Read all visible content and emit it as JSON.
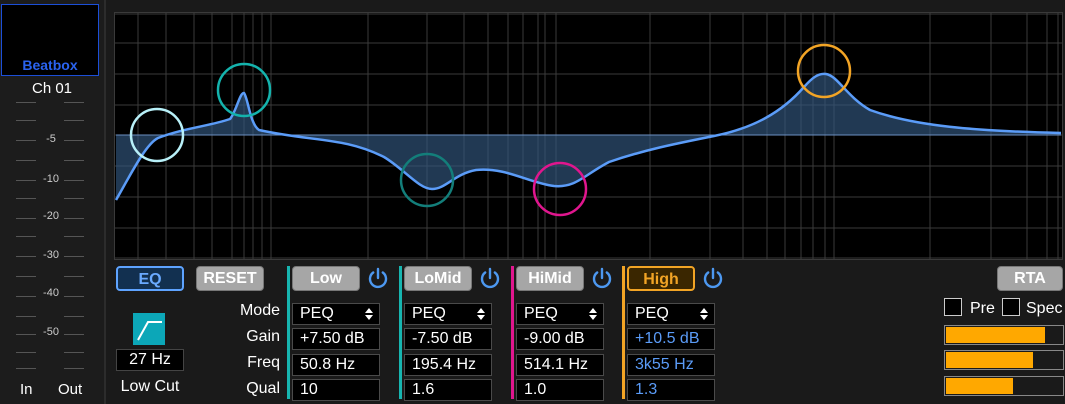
{
  "channel": {
    "name": "Beatbox",
    "number": "Ch 01"
  },
  "meter": {
    "scale_labels": [
      "-5",
      "-10",
      "-20",
      "-30",
      "-40",
      "-50"
    ],
    "in_label": "In",
    "out_label": "Out"
  },
  "graph": {
    "accent_color": "#5b9cf8",
    "band_markers": [
      {
        "name": "Low Cut",
        "color": "#b8f0f8"
      },
      {
        "name": "Low",
        "color": "#14b3ad"
      },
      {
        "name": "LoMid",
        "color": "#137e7a"
      },
      {
        "name": "HiMid",
        "color": "#e0168e"
      },
      {
        "name": "High",
        "color": "#f2a425"
      }
    ]
  },
  "toolbar": {
    "eq_label": "EQ",
    "reset_label": "RESET",
    "rta_label": "RTA"
  },
  "low_cut": {
    "freq": "27 Hz",
    "label": "Low Cut",
    "icon": "highpass-filter-icon"
  },
  "row_labels": {
    "mode": "Mode",
    "gain": "Gain",
    "freq": "Freq",
    "qual": "Qual"
  },
  "bands": [
    {
      "label": "Low",
      "color": "#17b5b0",
      "mode": "PEQ",
      "gain": "+7.50 dB",
      "freq": "50.8 Hz",
      "qual": "10",
      "value_color": "#ffffff",
      "active": false
    },
    {
      "label": "LoMid",
      "color": "#17b5b0",
      "mode": "PEQ",
      "gain": "-7.50 dB",
      "freq": "195.4 Hz",
      "qual": "1.6",
      "value_color": "#ffffff",
      "active": false
    },
    {
      "label": "HiMid",
      "color": "#e0168e",
      "mode": "PEQ",
      "gain": "-9.00 dB",
      "freq": "514.1 Hz",
      "qual": "1.0",
      "value_color": "#ffffff",
      "active": false
    },
    {
      "label": "High",
      "color": "#f2a425",
      "mode": "PEQ",
      "gain": "+10.5 dB",
      "freq": "3k55 Hz",
      "qual": "1.3",
      "value_color": "#5b9cf8",
      "active": true
    }
  ],
  "rta": {
    "pre_label": "Pre",
    "spec_label": "Spec",
    "levels": [
      0.84,
      0.74,
      0.57
    ]
  }
}
